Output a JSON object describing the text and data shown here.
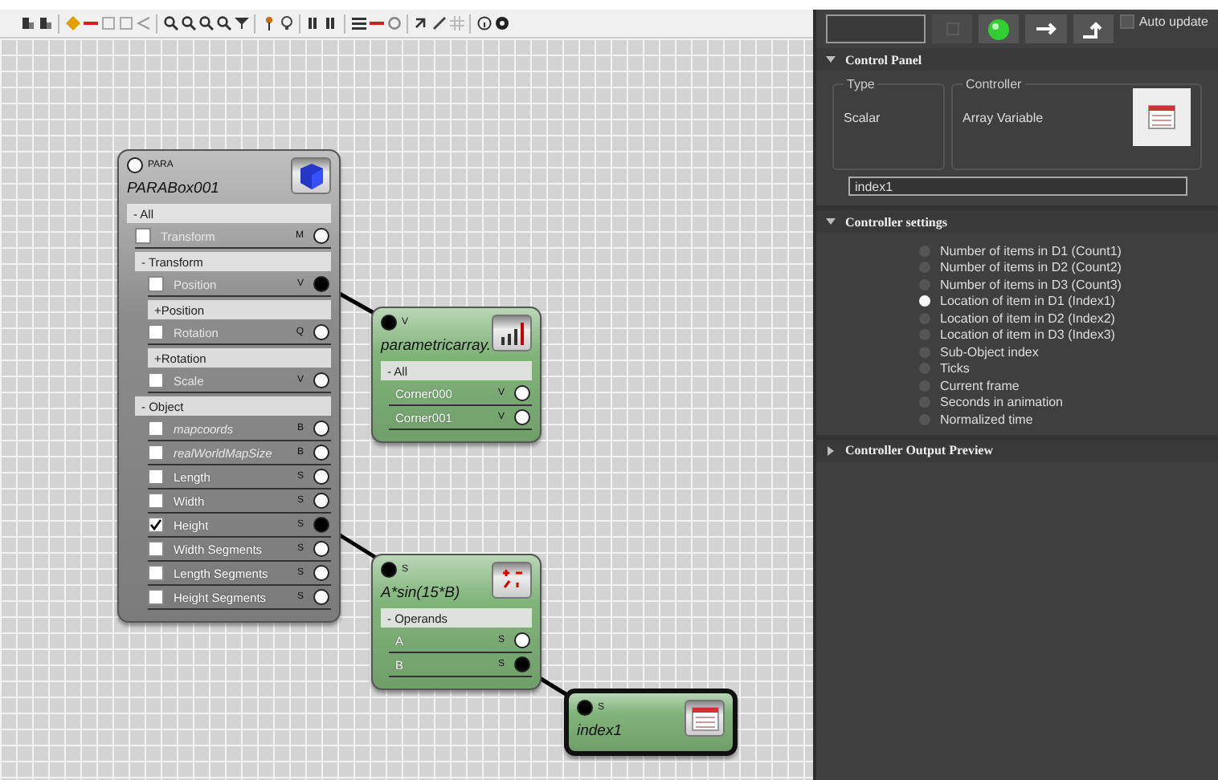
{
  "nodes": [
    {
      "header": "PARA",
      "title": "PARABox001",
      "color": "#8c8c8c",
      "selected": false,
      "input_connected": false,
      "rows": [
        {
          "kind": "group",
          "label": "- All",
          "children": [
            {
              "kind": "param",
              "label": "Transform",
              "socket": "M",
              "checked": false,
              "connected": false,
              "dimmed": true,
              "italic": false
            },
            {
              "kind": "group",
              "label": "- Transform",
              "children": [
                {
                  "kind": "param",
                  "label": "Position",
                  "socket": "V",
                  "checked": false,
                  "connected": true,
                  "dimmed": true,
                  "italic": false
                },
                {
                  "kind": "group",
                  "label": "+Position"
                },
                {
                  "kind": "param",
                  "label": "Rotation",
                  "socket": "Q",
                  "checked": false,
                  "connected": false,
                  "dimmed": true,
                  "italic": false
                },
                {
                  "kind": "group",
                  "label": "+Rotation"
                },
                {
                  "kind": "param",
                  "label": "Scale",
                  "socket": "V",
                  "checked": false,
                  "connected": false,
                  "dimmed": true,
                  "italic": false
                }
              ]
            },
            {
              "kind": "group",
              "label": "- Object",
              "children": [
                {
                  "kind": "param",
                  "label": "mapcoords",
                  "socket": "B",
                  "checked": false,
                  "connected": false,
                  "dimmed": true,
                  "italic": true
                },
                {
                  "kind": "param",
                  "label": "realWorldMapSize",
                  "socket": "B",
                  "checked": false,
                  "connected": false,
                  "dimmed": true,
                  "italic": true
                },
                {
                  "kind": "param",
                  "label": "Length",
                  "socket": "S",
                  "checked": false,
                  "connected": false,
                  "dimmed": false,
                  "italic": false
                },
                {
                  "kind": "param",
                  "label": "Width",
                  "socket": "S",
                  "checked": false,
                  "connected": false,
                  "dimmed": false,
                  "italic": false
                },
                {
                  "kind": "param",
                  "label": "Height",
                  "socket": "S",
                  "checked": true,
                  "connected": true,
                  "dimmed": false,
                  "italic": false
                },
                {
                  "kind": "param",
                  "label": "Width Segments",
                  "socket": "S",
                  "checked": false,
                  "connected": false,
                  "dimmed": false,
                  "italic": false
                },
                {
                  "kind": "param",
                  "label": "Length Segments",
                  "socket": "S",
                  "checked": false,
                  "connected": false,
                  "dimmed": false,
                  "italic": false
                },
                {
                  "kind": "param",
                  "label": "Height Segments",
                  "socket": "S",
                  "checked": false,
                  "connected": false,
                  "dimmed": false,
                  "italic": false
                }
              ]
            }
          ]
        }
      ]
    },
    {
      "header": "V",
      "title": "parametricarray.",
      "color": "#80b479",
      "selected": false,
      "input_connected": true,
      "rows": [
        {
          "kind": "group",
          "label": "- All",
          "children": [
            {
              "kind": "socket",
              "label": "Corner000",
              "socket": "V",
              "connected": false
            },
            {
              "kind": "socket",
              "label": "Corner001",
              "socket": "V",
              "connected": false
            }
          ]
        }
      ]
    },
    {
      "header": "S",
      "title": "A*sin(15*B)",
      "color": "#80b479",
      "selected": false,
      "input_connected": true,
      "rows": [
        {
          "kind": "group",
          "label": "- Operands",
          "children": [
            {
              "kind": "socket",
              "label": "A",
              "socket": "S",
              "connected": false
            },
            {
              "kind": "socket",
              "label": "B",
              "socket": "S",
              "connected": true
            }
          ]
        }
      ]
    },
    {
      "header": "S",
      "title": "index1",
      "color": "#80b479",
      "selected": true,
      "input_connected": true
    }
  ],
  "panel": {
    "auto_update": {
      "label": "Auto update",
      "checked": false
    },
    "control_panel": {
      "title": "Control Panel",
      "expanded": true,
      "type_label": "Type",
      "type_value": "Scalar",
      "controller_label": "Controller",
      "controller_value": "Array Variable",
      "name_value": "index1"
    },
    "settings": {
      "title": "Controller settings",
      "expanded": true,
      "options": [
        {
          "label": "Number of items in D1 (Count1)",
          "selected": false
        },
        {
          "label": "Number of items in D2 (Count2)",
          "selected": false
        },
        {
          "label": "Number of items in D3 (Count3)",
          "selected": false
        },
        {
          "label": "Location of item in D1 (Index1)",
          "selected": true
        },
        {
          "label": "Location of item in D2 (Index2)",
          "selected": false
        },
        {
          "label": "Location of item in D3 (Index3)",
          "selected": false
        },
        {
          "label": "Sub-Object index",
          "selected": false
        },
        {
          "label": "Ticks",
          "selected": false
        },
        {
          "label": "Current frame",
          "selected": false
        },
        {
          "label": "Seconds in animation",
          "selected": false
        },
        {
          "label": "Normalized time",
          "selected": false
        }
      ]
    },
    "preview": {
      "title": "Controller Output Preview",
      "expanded": false
    }
  }
}
